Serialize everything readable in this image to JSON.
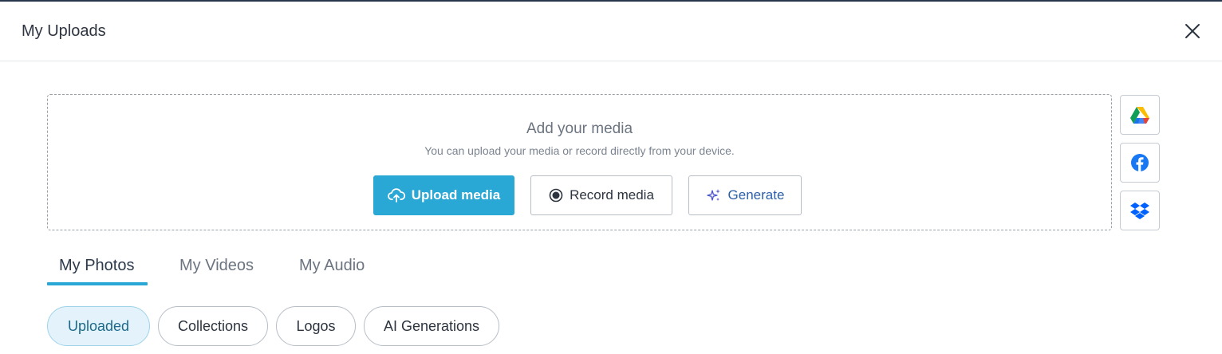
{
  "header": {
    "title": "My Uploads",
    "close_icon": "close-icon"
  },
  "dropzone": {
    "title": "Add your media",
    "subtitle": "You can upload your media or record directly from your device.",
    "upload_label": "Upload media",
    "record_label": "Record media",
    "generate_label": "Generate"
  },
  "integrations": [
    {
      "name": "google-drive-icon"
    },
    {
      "name": "facebook-icon"
    },
    {
      "name": "dropbox-icon"
    }
  ],
  "tabs": [
    {
      "label": "My Photos",
      "active": true
    },
    {
      "label": "My Videos",
      "active": false
    },
    {
      "label": "My Audio",
      "active": false
    }
  ],
  "filters": [
    {
      "label": "Uploaded",
      "active": true
    },
    {
      "label": "Collections",
      "active": false
    },
    {
      "label": "Logos",
      "active": false
    },
    {
      "label": "AI Generations",
      "active": false
    }
  ],
  "colors": {
    "accent": "#29a7d5",
    "header_border": "#27364a",
    "generate_text": "#2b5fa8",
    "active_pill_bg": "#e4f3fb"
  }
}
